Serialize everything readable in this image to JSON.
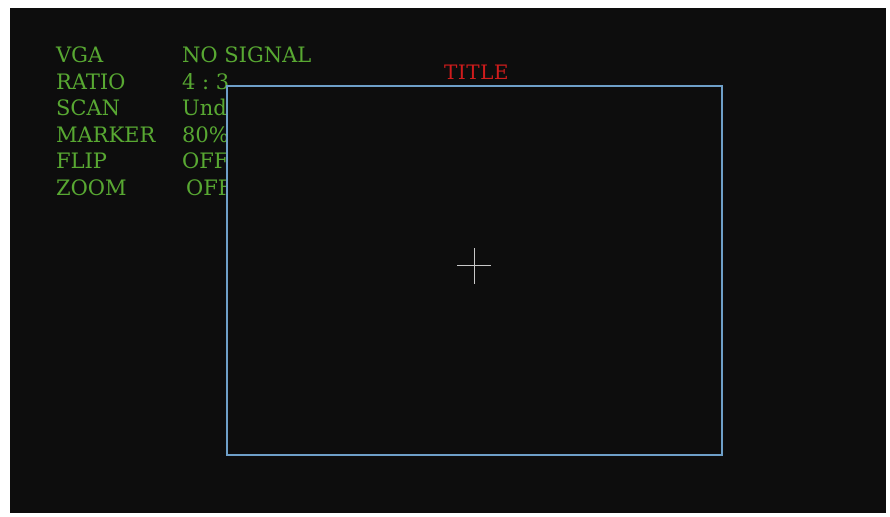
{
  "osd": {
    "rows": [
      {
        "label": "VGA",
        "value": "NO SIGNAL"
      },
      {
        "label": "RATIO",
        "value": "4 : 3"
      },
      {
        "label": "SCAN",
        "value": "UnderScan"
      },
      {
        "label": "MARKER",
        "value": "80%"
      },
      {
        "label": "FLIP",
        "value": "OFF"
      },
      {
        "label": "ZOOM",
        "value": "OFF"
      }
    ]
  },
  "title": {
    "text": "TITLE"
  },
  "colors": {
    "osd_text": "#58a832",
    "title_text": "#d01c1c",
    "frame_border": "#6e9fc8",
    "crosshair": "#c8c8c8",
    "background": "#0d0d0d"
  }
}
